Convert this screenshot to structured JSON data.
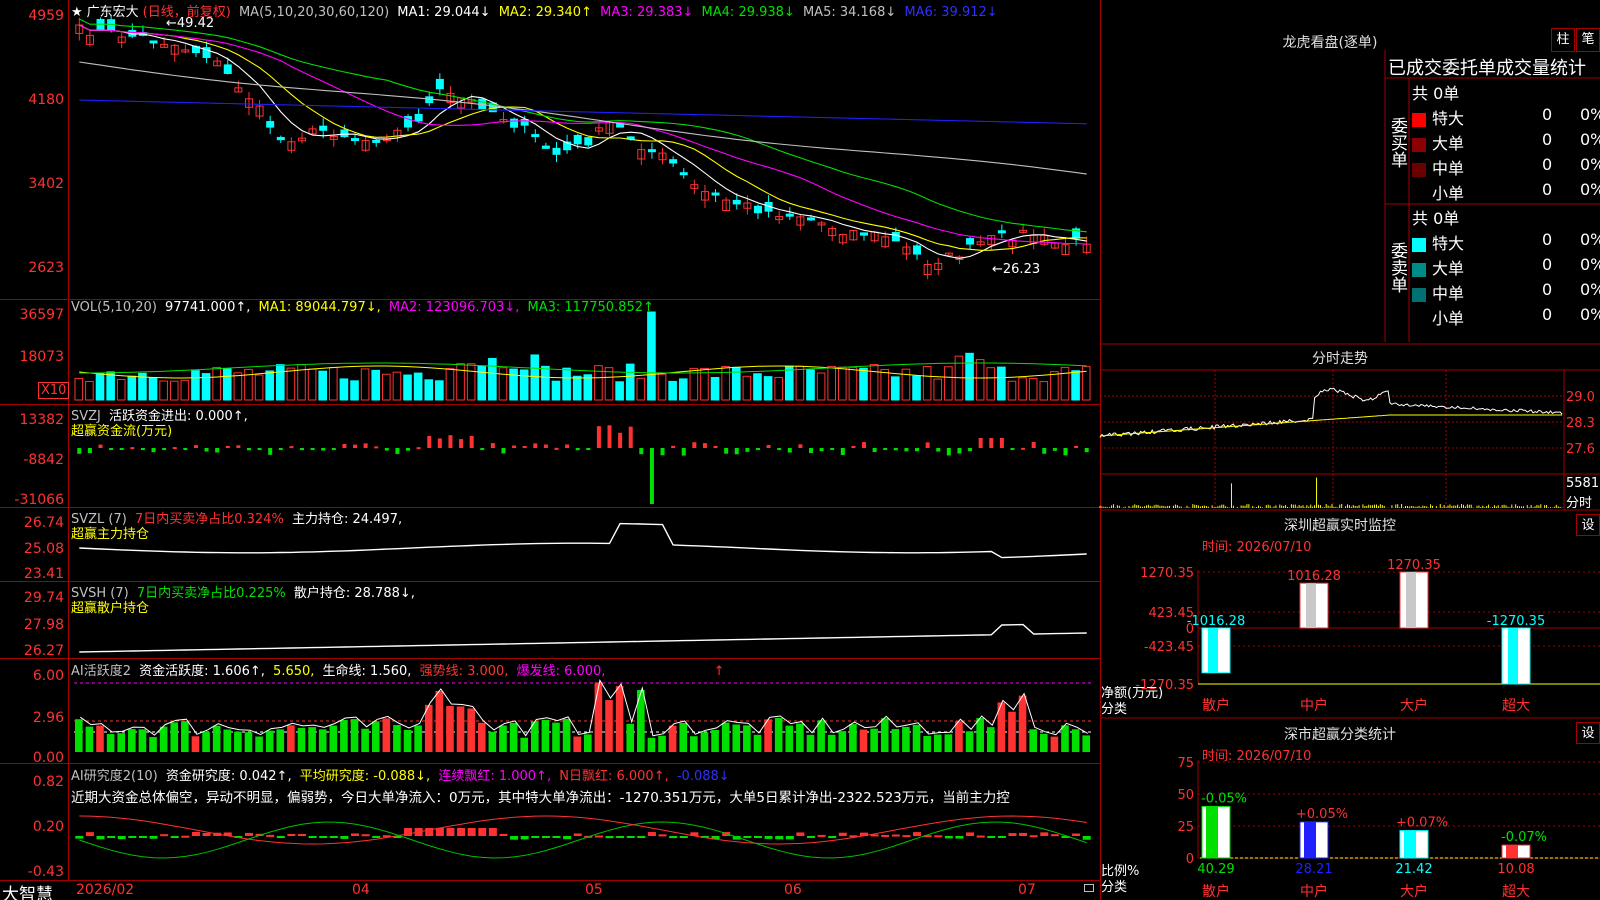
{
  "colors": {
    "up": "#ff3232",
    "down": "#00ffff",
    "green": "#00e000",
    "border": "#a00000",
    "yellow": "#ffff00",
    "magenta": "#ff00ff"
  },
  "main": {
    "star": "★",
    "stock": "广东宏大",
    "period": "(日线，前复权)",
    "ma_label": "MA(5,10,20,30,60,120)",
    "ma1": "MA1: 29.044↓",
    "ma2": "MA2: 29.340↑",
    "ma3": "MA3: 29.383↓",
    "ma4": "MA4: 29.938↓",
    "ma5": "MA5: 34.168↓",
    "ma6": "MA6: 39.912↓",
    "high_tag": "49.42",
    "low_tag": "←26.23",
    "y_labels": [
      "4959",
      "4180",
      "3402",
      "2623"
    ]
  },
  "vol": {
    "label": "VOL(5,10,20)",
    "value": "97741.000↑,",
    "ma1": "MA1: 89044.797↓,",
    "ma2": "MA2: 123096.703↓,",
    "ma3": "MA3: 117750.852↑",
    "y_labels": [
      "36597",
      "18073"
    ],
    "unit": "X10"
  },
  "svzj": {
    "label": "SVZJ",
    "text": "活跃资金进出: 0.000↑,",
    "sub": "超赢资金流(万元)",
    "y_labels": [
      "13382",
      "-8842",
      "-31066"
    ]
  },
  "svzl": {
    "label": "SVZL (7)",
    "ratio": "7日内买卖净占比0.324%",
    "hold": "主力持仓: 24.497,",
    "sub": "超赢主力持仓",
    "y_labels": [
      "26.74",
      "25.08",
      "23.41"
    ]
  },
  "svsh": {
    "label": "SVSH (7)",
    "ratio": "7日内买卖净占比0.225%",
    "hold": "散户持仓: 28.788↓,",
    "sub": "超赢散户持仓",
    "y_labels": [
      "29.74",
      "27.98",
      "26.27"
    ]
  },
  "ai1": {
    "label": "AI活跃度2",
    "a": "资金活跃度: 1.606↑,",
    "b": "5.650,",
    "c": "生命线: 1.560,",
    "d": "强势线: 3.000,",
    "e": "爆发线: 6.000,",
    "arrow": "↑",
    "y_labels": [
      "6.00",
      "2.96",
      "0.00"
    ]
  },
  "ai2": {
    "label": "AI研究度2(10)",
    "a": "资金研究度: 0.042↑,",
    "b": "平均研究度: -0.088↓,",
    "c": "连续飘红: 1.000↑,",
    "d": "N日飘红: 6.000↑,",
    "e": "-0.088↓",
    "note": "近期大资金总体偏空，异动不明显，偏弱势，今日大单净流入：0万元，其中特大单净流出：-1270.351万元，大单5日累计净出-2322.523万元，当前主力控",
    "y_labels": [
      "0.82",
      "0.20",
      "-0.43"
    ]
  },
  "xaxis": {
    "brand": "大智慧",
    "labels": [
      "2026/02",
      "04",
      "05",
      "06",
      "07"
    ]
  },
  "right": {
    "lhkp_title": "龙虎看盘(逐单)",
    "btn_zhu": "柱",
    "btn_bi": "笔",
    "order_header": "已成交委托单成交量统计",
    "buy": {
      "side": "委买单",
      "total": "共 0单",
      "rows": [
        {
          "name": "特大",
          "count": "0",
          "pct": "0%"
        },
        {
          "name": "大单",
          "count": "0",
          "pct": "0%"
        },
        {
          "name": "中单",
          "count": "0",
          "pct": "0%"
        },
        {
          "name": "小单",
          "count": "0",
          "pct": "0%"
        }
      ]
    },
    "sell": {
      "side": "委卖单",
      "total": "共 0单",
      "rows": [
        {
          "name": "特大",
          "count": "0",
          "pct": "0%"
        },
        {
          "name": "大单",
          "count": "0",
          "pct": "0%"
        },
        {
          "name": "中单",
          "count": "0",
          "pct": "0%"
        },
        {
          "name": "小单",
          "count": "0",
          "pct": "0%"
        }
      ]
    },
    "intraday": {
      "title": "分时走势",
      "p1": "29.0",
      "p2": "28.3",
      "p3": "27.6",
      "vol": "5581",
      "vol_unit": "分时"
    },
    "monitor": {
      "title": "深圳超赢实时监控",
      "btn": "设",
      "time": "时间: 2026/07/10",
      "y_labels": [
        "1270.35",
        "423.45",
        "0",
        "-423.45",
        "-1270.35"
      ],
      "ylabel": "净额(万元)",
      "xlabel": "分类",
      "cats": [
        "散户",
        "中户",
        "大户",
        "超大"
      ],
      "values": [
        -1016.28,
        1016.28,
        1270.35,
        -1270.35
      ],
      "value_labels": [
        "-1016.28",
        "1016.28",
        "1270.35",
        "-1270.35"
      ]
    },
    "classify": {
      "title": "深市超赢分类统计",
      "btn": "设",
      "time": "时间: 2026/07/10",
      "y_labels": [
        "75",
        "50",
        "25",
        "0"
      ],
      "ylabel": "比例%",
      "xlabel": "分类",
      "cats": [
        "散户",
        "中户",
        "大户",
        "超大"
      ],
      "values": [
        40.29,
        28.21,
        21.42,
        10.08
      ],
      "value_labels": [
        "40.29",
        "28.21",
        "21.42",
        "10.08"
      ],
      "changes": [
        "-0.05%",
        "+0.05%",
        "+0.07%",
        "-0.07%"
      ]
    }
  }
}
